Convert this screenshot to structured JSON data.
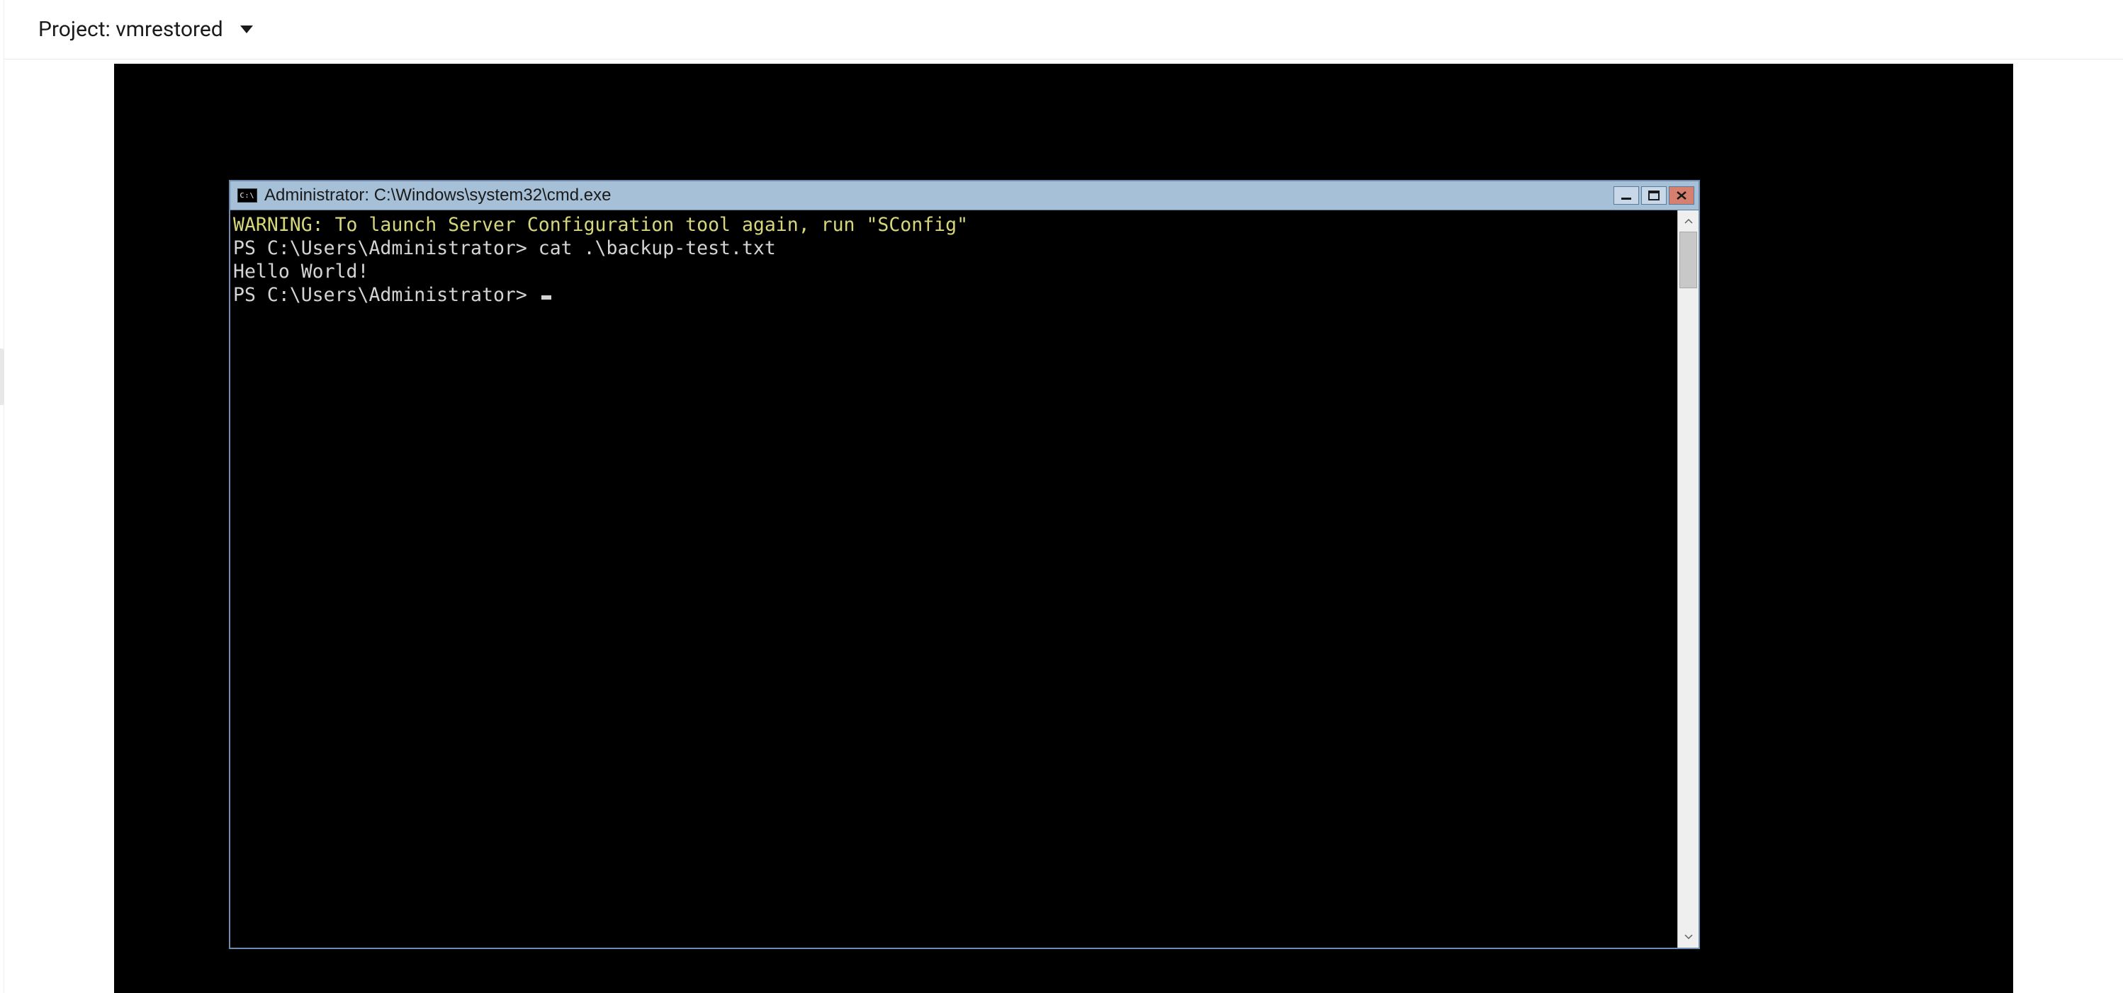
{
  "header": {
    "project_prefix": "Project: ",
    "project_name": "vmrestored"
  },
  "cmd": {
    "icon_text": "C:\\",
    "title": "Administrator: C:\\Windows\\system32\\cmd.exe",
    "lines": {
      "warning": "WARNING: To launch Server Configuration tool again, run \"SConfig\"",
      "prompt1": "PS C:\\Users\\Administrator> cat .\\backup-test.txt",
      "output": "Hello World!",
      "prompt2": "PS C:\\Users\\Administrator> "
    }
  },
  "icons": {
    "minimize": "minimize-icon",
    "maximize": "maximize-icon",
    "close": "close-icon",
    "scroll_up": "chevron-up-icon",
    "scroll_down": "chevron-down-icon",
    "caret": "caret-down-icon",
    "cmd": "cmd-icon"
  }
}
